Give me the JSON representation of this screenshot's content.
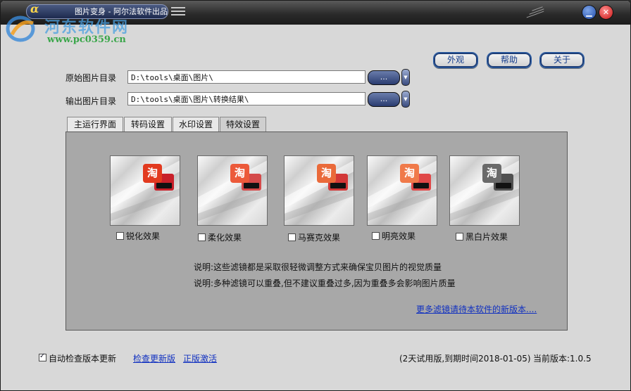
{
  "titlebar": {
    "title": "图片变身 - 阿尔法软件出品",
    "logo_glyph": "α"
  },
  "watermark": {
    "site_name": "河东软件网",
    "url": "www.pc0359.cn"
  },
  "window_controls": {
    "minimize_glyph": "▁",
    "close_glyph": "✕"
  },
  "top_buttons": {
    "skin": "外观",
    "help": "帮助",
    "about": "关于"
  },
  "paths": {
    "source_label": "原始图片目录",
    "source_value": "D:\\tools\\桌面\\图片\\",
    "output_label": "输出图片目录",
    "output_value": "D:\\tools\\桌面\\图片\\转换结果\\",
    "browse_label": "...",
    "dropdown_glyph": "▼"
  },
  "tabs": [
    {
      "label": "主运行界面",
      "active": false
    },
    {
      "label": "转码设置",
      "active": false
    },
    {
      "label": "水印设置",
      "active": false
    },
    {
      "label": "特效设置",
      "active": true
    }
  ],
  "effects": [
    {
      "label": "锐化效果",
      "checked": false,
      "tao_color": "#e23a1f",
      "box_color": "#c8202a"
    },
    {
      "label": "柔化效果",
      "checked": false,
      "tao_color": "#ec5a3a",
      "box_color": "#d44a4a"
    },
    {
      "label": "马赛克效果",
      "checked": false,
      "tao_color": "#ea6a3a",
      "box_color": "#d23838"
    },
    {
      "label": "明亮效果",
      "checked": false,
      "tao_color": "#f07a4a",
      "box_color": "#e04848"
    },
    {
      "label": "黑白片效果",
      "checked": false,
      "tao_color": "#6a6a6a",
      "box_color": "#505050"
    }
  ],
  "tao_char": "淘",
  "notes": {
    "line1": "说明:这些滤镜都是采取很轻微调整方式来确保宝贝图片的视觉质量",
    "line2": "说明:多种滤镜可以重叠,但不建议重叠过多,因为重叠多会影响图片质量"
  },
  "more_filters_link": "更多滤镜请待本软件的新版本....",
  "footer": {
    "auto_update_label": "自动检查版本更新",
    "auto_update_checked": true,
    "check_update_link": "检查更新版",
    "activate_link": "正版激活",
    "trial_info": "(2天试用版,到期时间2018-01-05)",
    "version": "当前版本:1.0.5"
  }
}
